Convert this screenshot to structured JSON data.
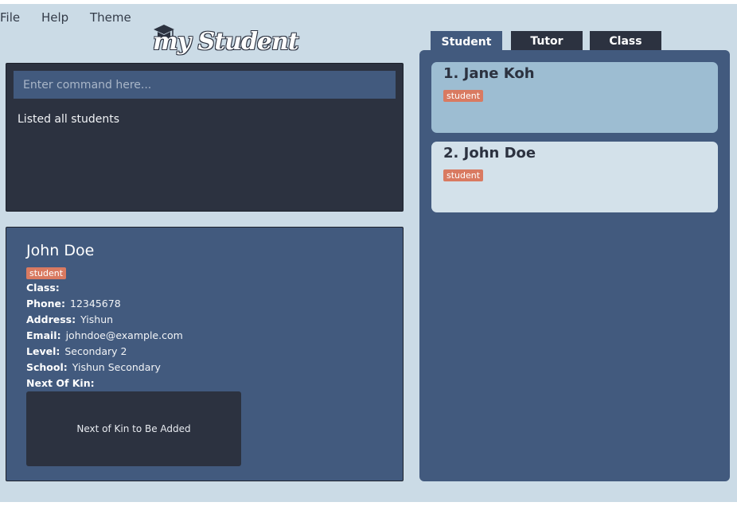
{
  "menu": {
    "items": [
      "File",
      "Help",
      "Theme"
    ]
  },
  "logo": {
    "text": "my Student"
  },
  "command": {
    "placeholder": "Enter command here...",
    "value": "",
    "result": "Listed all students"
  },
  "detail": {
    "name": "John Doe",
    "tag": "student",
    "fields": [
      {
        "label": "Class:",
        "value": ""
      },
      {
        "label": "Phone:",
        "value": "12345678"
      },
      {
        "label": "Address:",
        "value": "Yishun"
      },
      {
        "label": "Email:",
        "value": "johndoe@example.com"
      },
      {
        "label": "Level:",
        "value": "Secondary 2"
      },
      {
        "label": "School:",
        "value": "Yishun Secondary"
      },
      {
        "label": "Next Of Kin:",
        "value": ""
      }
    ],
    "next_of_kin_placeholder": "Next of Kin to Be Added"
  },
  "tabs": [
    {
      "label": "Student",
      "active": true
    },
    {
      "label": "Tutor",
      "active": false
    },
    {
      "label": "Class",
      "active": false
    }
  ],
  "list": {
    "cards": [
      {
        "name": "1. Jane Koh",
        "tag": "student",
        "selected": true
      },
      {
        "name": "2. John Doe",
        "tag": "student",
        "selected": false
      }
    ]
  },
  "colors": {
    "background": "#cbdbe6",
    "panel_dark": "#2c3240",
    "panel_blue": "#425a7e",
    "tag": "#d97a61",
    "card_selected": "#9dbdd2",
    "card": "#d3e1ea"
  }
}
